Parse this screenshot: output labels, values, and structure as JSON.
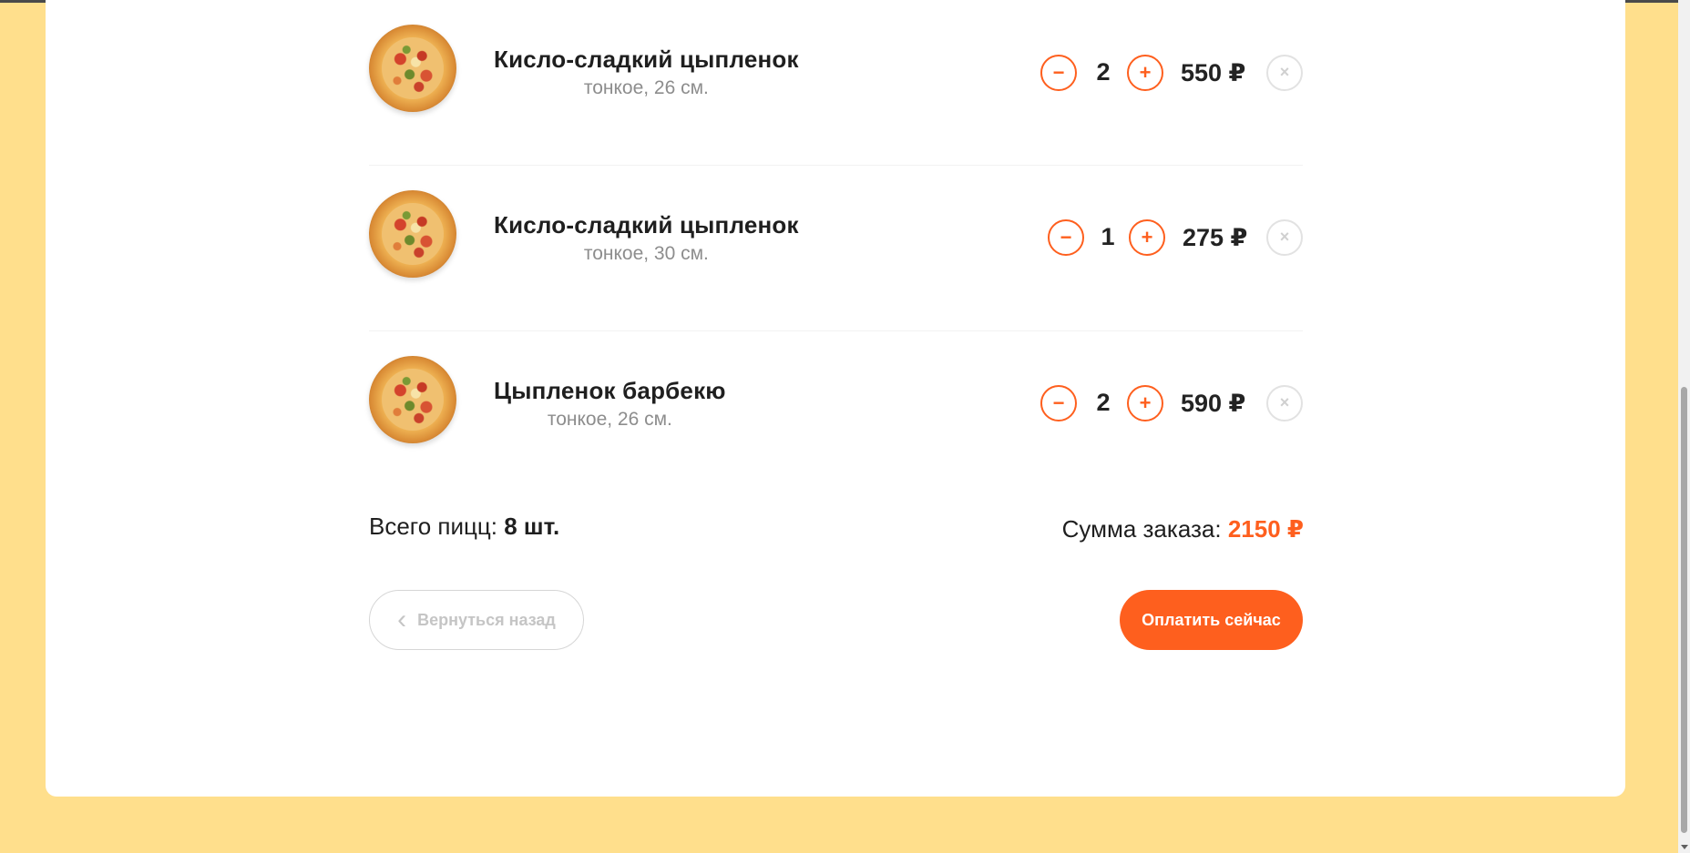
{
  "cart": {
    "items": [
      {
        "name": "Кисло-сладкий цыпленок",
        "details": "тонкое, 26 см.",
        "count": "2",
        "price": "550 ₽",
        "minus": "−",
        "plus": "+",
        "remove": "×"
      },
      {
        "name": "Кисло-сладкий цыпленок",
        "details": "тонкое, 30 см.",
        "count": "1",
        "price": "275 ₽",
        "minus": "−",
        "plus": "+",
        "remove": "×"
      },
      {
        "name": "Цыпленок барбекю",
        "details": "тонкое, 26 см.",
        "count": "2",
        "price": "590 ₽",
        "minus": "−",
        "plus": "+",
        "remove": "×"
      }
    ],
    "total_count_label": "Всего пицц:",
    "total_count_value": "8 шт.",
    "total_sum_label": "Сумма заказа:",
    "total_sum_value": "2150 ₽",
    "back_label": "Вернуться назад",
    "back_icon": "‹",
    "pay_label": "Оплатить сейчас"
  },
  "colors": {
    "accent": "#fe5f1e",
    "page_background": "#ffdf8c",
    "card_background": "#ffffff"
  },
  "icons": {
    "item_image": "pizza-image",
    "decrease": "minus-icon",
    "increase": "plus-icon",
    "remove": "close-icon",
    "back": "chevron-left-icon"
  }
}
